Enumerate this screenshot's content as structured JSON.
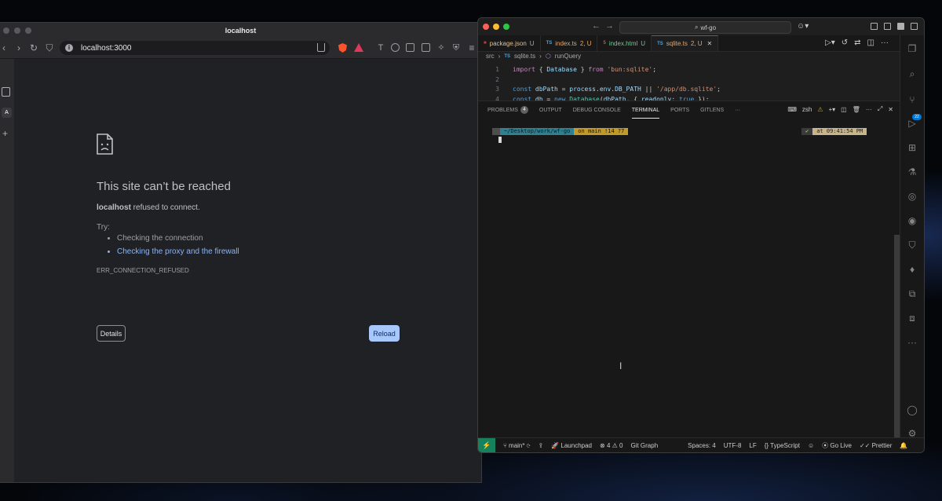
{
  "browser": {
    "window_title": "localhost",
    "url": "localhost:3000",
    "error": {
      "title": "This site can’t be reached",
      "host": "localhost",
      "refused_text": " refused to connect.",
      "try_label": "Try:",
      "suggestions": [
        "Checking the connection",
        "Checking the proxy and the firewall"
      ],
      "code": "ERR_CONNECTION_REFUSED",
      "details_label": "Details",
      "reload_label": "Reload"
    },
    "side_badge": "A"
  },
  "vscode": {
    "search_text": "wf-go",
    "tabs": [
      {
        "icon": "package-icon",
        "label": "package.json",
        "status": "U",
        "active": false
      },
      {
        "icon": "TS",
        "label": "index.ts",
        "status": "2, U",
        "active": false
      },
      {
        "icon": "html-icon",
        "label": "index.html",
        "status": "U",
        "active": false
      },
      {
        "icon": "TS",
        "label": "sqlite.ts",
        "status": "2, U",
        "active": true
      }
    ],
    "breadcrumb": {
      "folder": "src",
      "file_icon": "TS",
      "file": "sqlite.ts",
      "symbol": "runQuery"
    },
    "code_lines": [
      {
        "n": "1",
        "tokens": [
          [
            "kw",
            "import"
          ],
          [
            "pl",
            " { "
          ],
          [
            "vr",
            "Database"
          ],
          [
            "pl",
            " } "
          ],
          [
            "kw",
            "from"
          ],
          [
            "pl",
            " "
          ],
          [
            "st2",
            "'bun:sqlite'"
          ],
          [
            "pl",
            ";"
          ]
        ]
      },
      {
        "n": "2",
        "tokens": []
      },
      {
        "n": "3",
        "tokens": [
          [
            "cn",
            "const"
          ],
          [
            "pl",
            " "
          ],
          [
            "vr",
            "dbPath"
          ],
          [
            "pl",
            " = "
          ],
          [
            "vr",
            "process"
          ],
          [
            "pl",
            "."
          ],
          [
            "vr",
            "env"
          ],
          [
            "pl",
            "."
          ],
          [
            "vr",
            "DB_PATH"
          ],
          [
            "pl",
            " || "
          ],
          [
            "st2",
            "'/app/db.sqlite'"
          ],
          [
            "pl",
            ";"
          ]
        ]
      },
      {
        "n": "4",
        "tokens": [
          [
            "cn",
            "const"
          ],
          [
            "pl",
            " "
          ],
          [
            "vr",
            "db"
          ],
          [
            "pl",
            " = "
          ],
          [
            "cn",
            "new"
          ],
          [
            "pl",
            " "
          ],
          [
            "cl",
            "Database"
          ],
          [
            "pl",
            "("
          ],
          [
            "vr",
            "dbPath"
          ],
          [
            "pl",
            ", { "
          ],
          [
            "vr",
            "readonly"
          ],
          [
            "pl",
            ": "
          ],
          [
            "cn",
            "true"
          ],
          [
            "pl",
            " });"
          ]
        ]
      }
    ],
    "panel": {
      "tabs": [
        {
          "label": "PROBLEMS",
          "badge": "4",
          "active": false
        },
        {
          "label": "OUTPUT",
          "active": false
        },
        {
          "label": "DEBUG CONSOLE",
          "active": false
        },
        {
          "label": "TERMINAL",
          "active": true
        },
        {
          "label": "PORTS",
          "active": false
        },
        {
          "label": "GITLENS",
          "active": false
        },
        {
          "label": "···",
          "active": false
        }
      ],
      "shell": "zsh",
      "prompt": {
        "os": "",
        "path": " ~/Desktop/work/wf-go",
        "git": " on  main !14 ?7",
        "check": "✔",
        "time": "at 09:41:54 PM "
      }
    },
    "status": {
      "branch": "main*",
      "launchpad": "Launchpad",
      "errors": "4",
      "warnings": "0",
      "git_graph": "Git Graph",
      "spaces": "Spaces: 4",
      "encoding": "UTF-8",
      "eol": "LF",
      "language": "TypeScript",
      "go_live": "Go Live",
      "prettier": "Prettier"
    },
    "activity_badge": "22"
  }
}
